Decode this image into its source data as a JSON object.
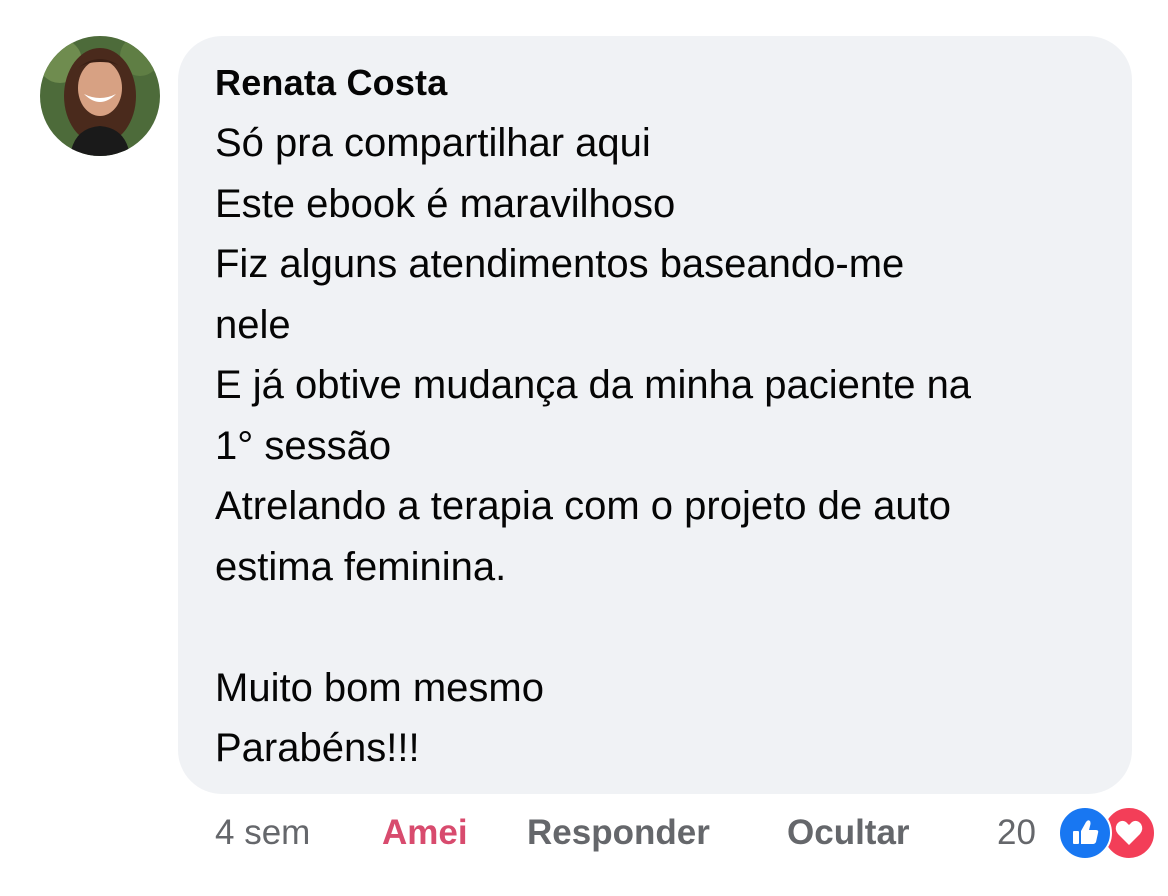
{
  "comment": {
    "author": "Renata Costa",
    "lines": [
      "Só pra compartilhar aqui",
      "Este ebook é maravilhoso",
      "Fiz alguns atendimentos baseando-me",
      "nele",
      "E já obtive mudança da minha paciente na",
      "1° sessão",
      "Atrelando a terapia com o projeto de auto",
      "estima feminina.",
      "",
      "Muito bom mesmo",
      "Parabéns!!!"
    ]
  },
  "actions": {
    "time": "4 sem",
    "love_label": "Amei",
    "reply_label": "Responder",
    "hide_label": "Ocultar"
  },
  "reactions": {
    "count": "20",
    "icons": [
      "like-icon",
      "heart-icon"
    ]
  },
  "colors": {
    "bubble": "#f0f2f5",
    "love": "#d84b6e",
    "like": "#1877f2",
    "heart": "#f33e58",
    "meta": "#65676b"
  }
}
